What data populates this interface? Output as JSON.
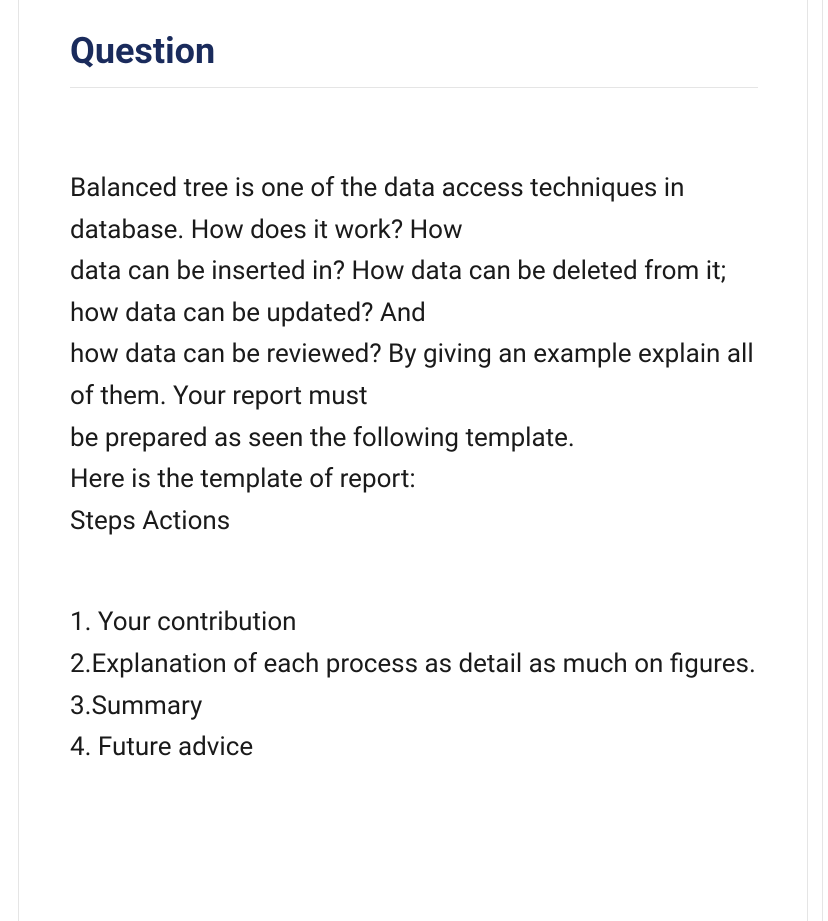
{
  "heading": "Question",
  "paragraph1_line1": "Balanced tree is one of the data access techniques in database. How does it work? How",
  "paragraph1_line2": "data can be inserted in? How data can be deleted from it; how data can be updated? And",
  "paragraph1_line3": "how data can be reviewed? By giving an example explain all of them. Your report must",
  "paragraph1_line4": "be prepared as seen the following template.",
  "paragraph1_line5": "Here is the template of report:",
  "paragraph1_line6": "Steps Actions",
  "step1": "1. Your contribution",
  "step2": "2.Explanation of each process as detail as much on figures.",
  "step3": "3.Summary",
  "step4": "4. Future advice"
}
